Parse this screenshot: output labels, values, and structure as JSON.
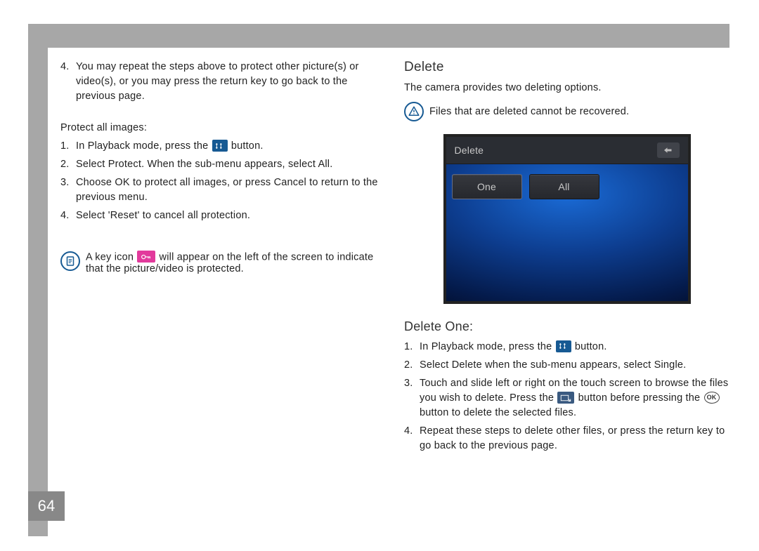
{
  "page_number": "64",
  "left": {
    "continued_item": "You may repeat the steps above to protect other picture(s) or video(s), or you may press the return key to go back to the previous page.",
    "protect_all_label": "Protect all images:",
    "steps": {
      "s1a": "In Playback mode, press the ",
      "s1b": " button.",
      "s2": "Select Protect. When the sub-menu appears, select All.",
      "s3": "Choose OK to protect all images, or press Cancel to return to the previous menu.",
      "s4": "Select 'Reset' to cancel all protection."
    },
    "note": {
      "a": "A key icon ",
      "b": " will appear on the left of the screen to indicate that the picture/video is protected."
    }
  },
  "right": {
    "heading": "Delete",
    "intro": "The camera provides two deleting options.",
    "warning": "Files that are deleted cannot be recovered.",
    "screenshot": {
      "title": "Delete",
      "btn_one": "One",
      "btn_all": "All"
    },
    "subheading": "Delete One:",
    "steps": {
      "s1a": "In Playback mode, press the ",
      "s1b": " button.",
      "s2": "Select Delete when the sub-menu appears, select Single.",
      "s3a": "Touch and slide left or right on the touch screen to browse the files you wish to delete. Press the ",
      "s3b": " button before pressing the ",
      "s3c": " button to delete the selected files.",
      "s4": "Repeat these steps to delete other files, or press the return key to go back to the previous page."
    }
  },
  "icons": {
    "tools": "tools-icon",
    "key": "key-icon",
    "note": "note-icon",
    "warn": "warning-icon",
    "select": "select-icon",
    "ok": "OK"
  }
}
